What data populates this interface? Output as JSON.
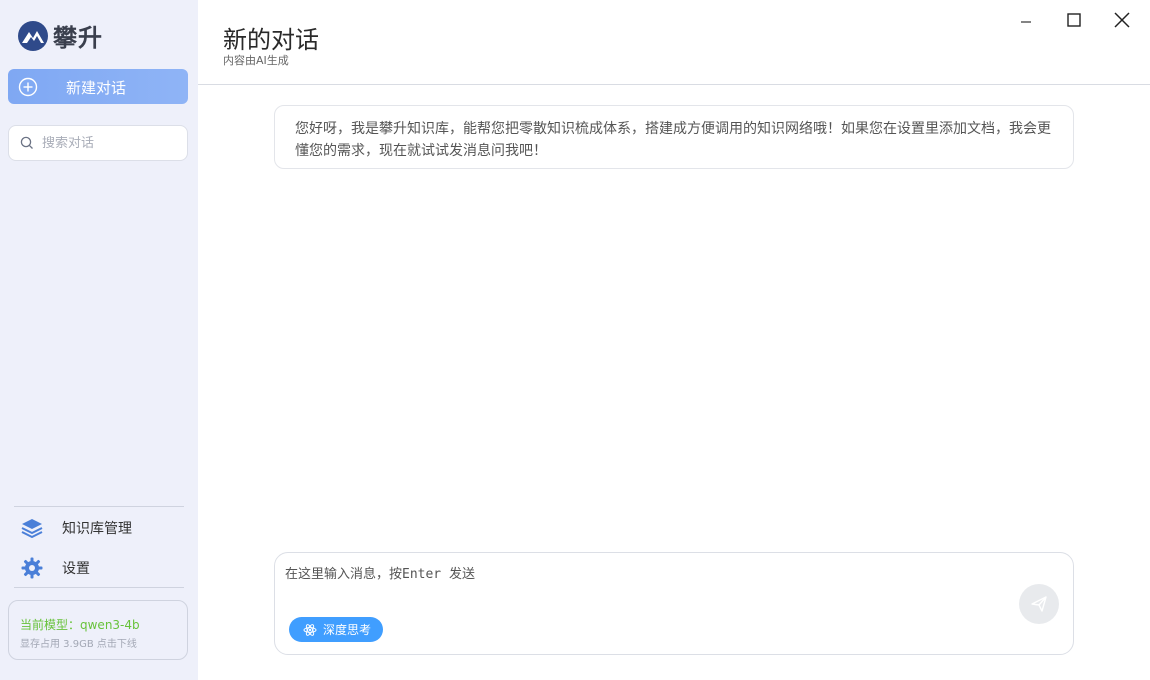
{
  "app": {
    "logo_text": "攀升"
  },
  "sidebar": {
    "new_chat_label": "新建对话",
    "search_placeholder": "搜索对话",
    "nav": [
      {
        "label": "知识库管理",
        "icon": "layers-icon"
      },
      {
        "label": "设置",
        "icon": "gear-icon"
      }
    ],
    "model": {
      "line1": "当前模型：qwen3-4b",
      "line2": "显存占用 3.9GB 点击下线"
    }
  },
  "header": {
    "title": "新的对话",
    "subtitle": "内容由AI生成"
  },
  "window_controls": [
    "minimize-icon",
    "maximize-icon",
    "close-icon"
  ],
  "chat": {
    "welcome_message": "您好呀，我是攀升知识库，能帮您把零散知识梳成体系，搭建成方便调用的知识网络哦！如果您在设置里添加文档，我会更懂您的需求，现在就试试发消息问我吧！"
  },
  "composer": {
    "placeholder": "在这里输入消息，按Enter 发送",
    "deep_think_label": "深度思考",
    "send_icon": "send-icon"
  },
  "colors": {
    "sidebar_bg": "#eef0fa",
    "accent": "#409eff",
    "new_chat_bg": "#8fb4f6",
    "model_green": "#67c23a"
  }
}
